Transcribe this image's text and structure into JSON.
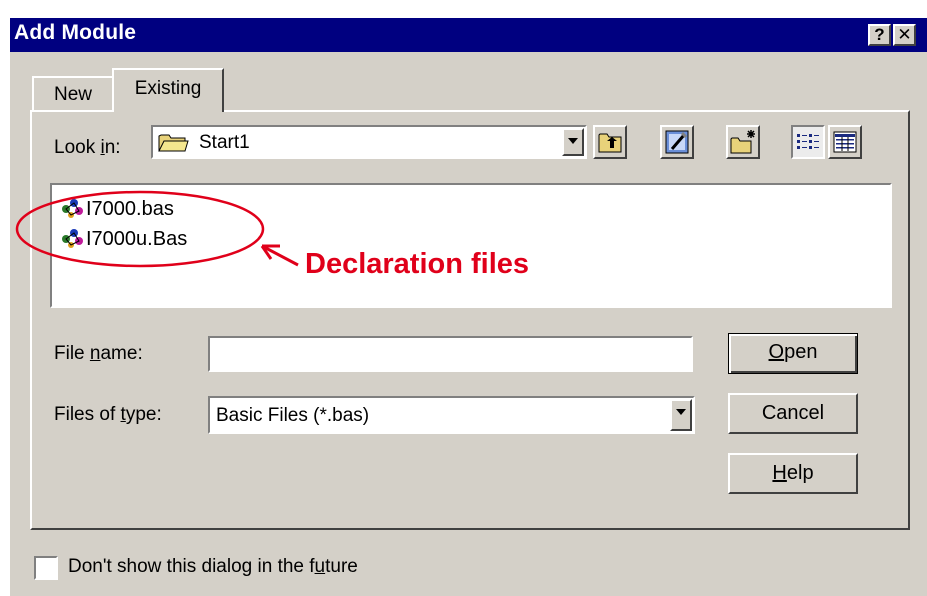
{
  "dialog": {
    "title": "Add Module",
    "help_label": "?",
    "close_label": "✕"
  },
  "tabs": [
    {
      "label": "New",
      "selected": false
    },
    {
      "label": "Existing",
      "selected": true
    }
  ],
  "look_in": {
    "label_prefix": "Look ",
    "label_hotkey": "i",
    "label_suffix": "n:",
    "value": "Start1",
    "icon": "folder-icon"
  },
  "toolbar": {
    "buttons": [
      "up-one-level-icon",
      "desktop-icon",
      "new-folder-icon",
      "list-view-icon",
      "details-view-icon"
    ]
  },
  "files": [
    {
      "name": "I7000.bas",
      "icon": "basic-file-icon"
    },
    {
      "name": "I7000u.Bas",
      "icon": "basic-file-icon"
    }
  ],
  "annotation": {
    "text": "Declaration files",
    "color": "#e0001a"
  },
  "file_name": {
    "label_prefix": "File ",
    "label_hotkey": "n",
    "label_suffix": "ame:",
    "value": ""
  },
  "file_type": {
    "label_prefix": "Files of ",
    "label_hotkey": "t",
    "label_suffix": "ype:",
    "value": "Basic Files (*.bas)"
  },
  "buttons": {
    "open_hotkey": "O",
    "open_rest": "pen",
    "cancel": "Cancel",
    "help_hotkey": "H",
    "help_rest": "elp"
  },
  "footer": {
    "checkbox_checked": false,
    "label_prefix": "Don't show this dialog in the f",
    "label_hotkey": "u",
    "label_suffix": "ture"
  },
  "colors": {
    "titlebar": "#000080",
    "face": "#d4d0c8",
    "annotation": "#e0001a"
  }
}
